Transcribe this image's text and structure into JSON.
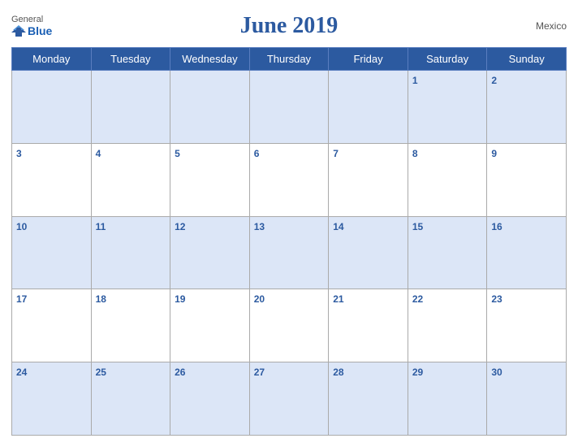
{
  "header": {
    "logo_general": "General",
    "logo_blue": "Blue",
    "title": "June 2019",
    "country": "Mexico"
  },
  "days_of_week": [
    "Monday",
    "Tuesday",
    "Wednesday",
    "Thursday",
    "Friday",
    "Saturday",
    "Sunday"
  ],
  "weeks": [
    [
      null,
      null,
      null,
      null,
      null,
      1,
      2
    ],
    [
      3,
      4,
      5,
      6,
      7,
      8,
      9
    ],
    [
      10,
      11,
      12,
      13,
      14,
      15,
      16
    ],
    [
      17,
      18,
      19,
      20,
      21,
      22,
      23
    ],
    [
      24,
      25,
      26,
      27,
      28,
      29,
      30
    ]
  ]
}
